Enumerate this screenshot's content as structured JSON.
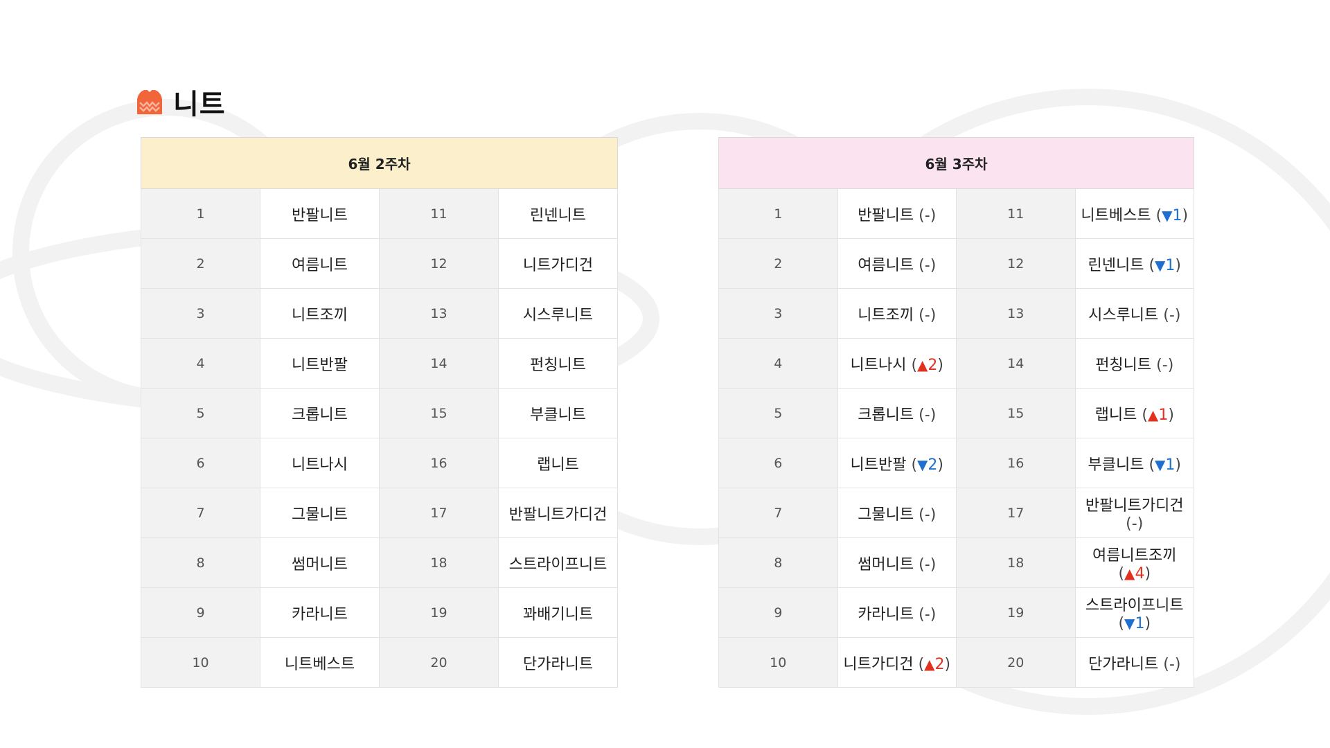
{
  "title": "니트",
  "icon": "sweater-icon",
  "colors": {
    "icon": "#f0663a",
    "up": "#e2321f",
    "down": "#1f6fce",
    "week1_header_bg": "#fbf0cb",
    "week2_header_bg": "#fbe3ef",
    "rank_cell_bg": "#f2f2f2"
  },
  "week1": {
    "header": "6월 2주차",
    "rows": [
      {
        "rank_a": "1",
        "name_a": "반팔니트",
        "rank_b": "11",
        "name_b": "린넨니트"
      },
      {
        "rank_a": "2",
        "name_a": "여름니트",
        "rank_b": "12",
        "name_b": "니트가디건"
      },
      {
        "rank_a": "3",
        "name_a": "니트조끼",
        "rank_b": "13",
        "name_b": "시스루니트"
      },
      {
        "rank_a": "4",
        "name_a": "니트반팔",
        "rank_b": "14",
        "name_b": "펀칭니트"
      },
      {
        "rank_a": "5",
        "name_a": "크롭니트",
        "rank_b": "15",
        "name_b": "부클니트"
      },
      {
        "rank_a": "6",
        "name_a": "니트나시",
        "rank_b": "16",
        "name_b": "랩니트"
      },
      {
        "rank_a": "7",
        "name_a": "그물니트",
        "rank_b": "17",
        "name_b": "반팔니트가디건"
      },
      {
        "rank_a": "8",
        "name_a": "썸머니트",
        "rank_b": "18",
        "name_b": "스트라이프니트"
      },
      {
        "rank_a": "9",
        "name_a": "카라니트",
        "rank_b": "19",
        "name_b": "꽈배기니트"
      },
      {
        "rank_a": "10",
        "name_a": "니트베스트",
        "rank_b": "20",
        "name_b": "단가라니트"
      }
    ]
  },
  "week2": {
    "header": "6월 3주차",
    "rows": [
      {
        "rank_a": "1",
        "name_a": "반팔니트",
        "change_a": {
          "dir": "same",
          "amount": ""
        },
        "rank_b": "11",
        "name_b": "니트베스트",
        "change_b": {
          "dir": "down",
          "amount": "1"
        }
      },
      {
        "rank_a": "2",
        "name_a": "여름니트",
        "change_a": {
          "dir": "same",
          "amount": ""
        },
        "rank_b": "12",
        "name_b": "린넨니트",
        "change_b": {
          "dir": "down",
          "amount": "1"
        }
      },
      {
        "rank_a": "3",
        "name_a": "니트조끼",
        "change_a": {
          "dir": "same",
          "amount": ""
        },
        "rank_b": "13",
        "name_b": "시스루니트",
        "change_b": {
          "dir": "same",
          "amount": ""
        }
      },
      {
        "rank_a": "4",
        "name_a": "니트나시",
        "change_a": {
          "dir": "up",
          "amount": "2"
        },
        "rank_b": "14",
        "name_b": "펀칭니트",
        "change_b": {
          "dir": "same",
          "amount": ""
        }
      },
      {
        "rank_a": "5",
        "name_a": "크롭니트",
        "change_a": {
          "dir": "same",
          "amount": ""
        },
        "rank_b": "15",
        "name_b": "랩니트",
        "change_b": {
          "dir": "up",
          "amount": "1"
        }
      },
      {
        "rank_a": "6",
        "name_a": "니트반팔",
        "change_a": {
          "dir": "down",
          "amount": "2"
        },
        "rank_b": "16",
        "name_b": "부클니트",
        "change_b": {
          "dir": "down",
          "amount": "1"
        }
      },
      {
        "rank_a": "7",
        "name_a": "그물니트",
        "change_a": {
          "dir": "same",
          "amount": ""
        },
        "rank_b": "17",
        "name_b": "반팔니트가디건",
        "change_b": {
          "dir": "same",
          "amount": ""
        }
      },
      {
        "rank_a": "8",
        "name_a": "썸머니트",
        "change_a": {
          "dir": "same",
          "amount": ""
        },
        "rank_b": "18",
        "name_b": "여름니트조끼",
        "change_b": {
          "dir": "up",
          "amount": "4"
        }
      },
      {
        "rank_a": "9",
        "name_a": "카라니트",
        "change_a": {
          "dir": "same",
          "amount": ""
        },
        "rank_b": "19",
        "name_b": "스트라이프니트",
        "change_b": {
          "dir": "down",
          "amount": "1"
        }
      },
      {
        "rank_a": "10",
        "name_a": "니트가디건",
        "change_a": {
          "dir": "up",
          "amount": "2"
        },
        "rank_b": "20",
        "name_b": "단가라니트",
        "change_b": {
          "dir": "same",
          "amount": ""
        }
      }
    ]
  }
}
